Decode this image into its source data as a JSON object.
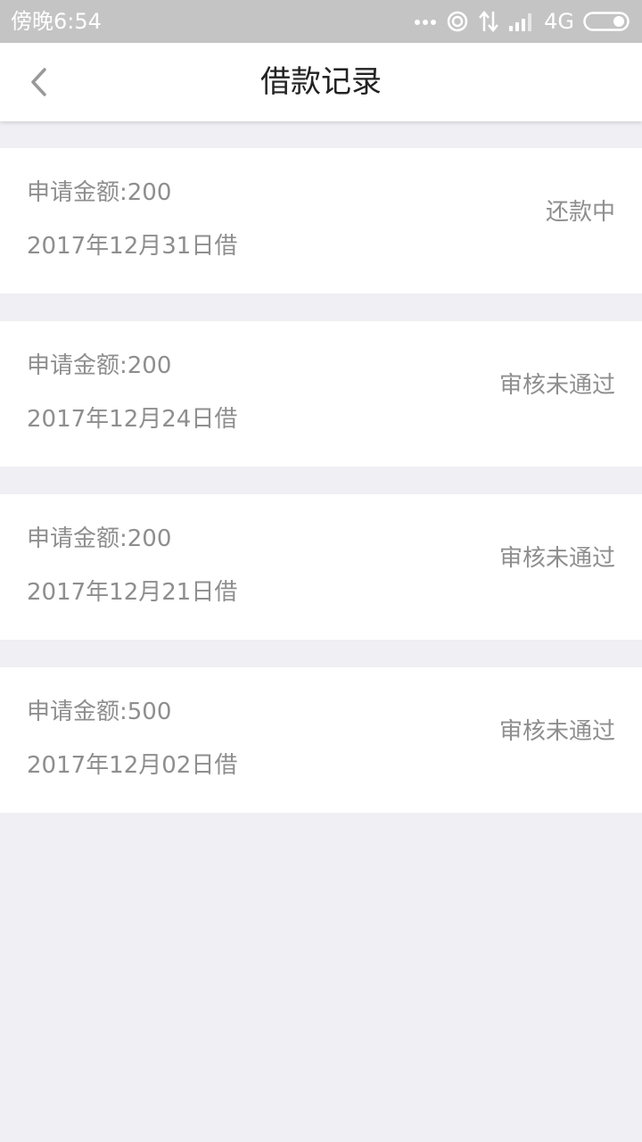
{
  "status_bar": {
    "time": "傍晚6:54",
    "network": "4G",
    "icons": [
      "dots-icon",
      "hotspot-icon",
      "data-arrows-icon",
      "signal-icon",
      "battery-icon"
    ]
  },
  "header": {
    "title": "借款记录",
    "back_icon": "chevron-left-icon"
  },
  "records": [
    {
      "amount": "申请金额:200",
      "date": "2017年12月31日借",
      "status": "还款中"
    },
    {
      "amount": "申请金额:200",
      "date": "2017年12月24日借",
      "status": "审核未通过"
    },
    {
      "amount": "申请金额:200",
      "date": "2017年12月21日借",
      "status": "审核未通过"
    },
    {
      "amount": "申请金额:500",
      "date": "2017年12月02日借",
      "status": "审核未通过"
    }
  ],
  "colors": {
    "page_background": "#efeff4",
    "status_bar": "#c4c4c4",
    "text_secondary": "#8e8e8e",
    "title_text": "#222222"
  }
}
